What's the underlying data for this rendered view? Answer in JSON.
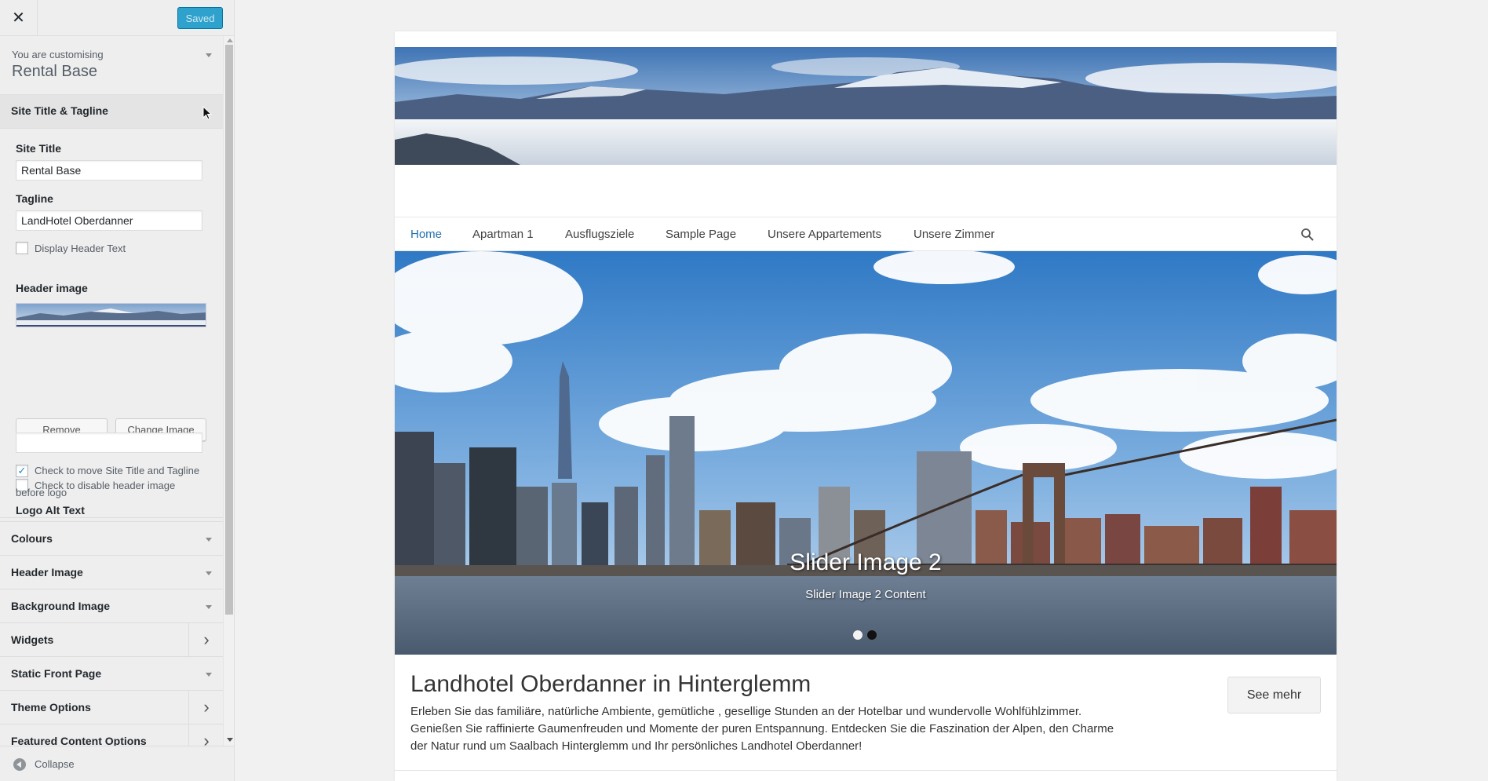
{
  "sidebar": {
    "close_icon": "close-icon",
    "saved_label": "Saved",
    "customising_label": "You are customising",
    "theme_name": "Rental Base",
    "open_section": {
      "title": "Site Title & Tagline",
      "site_title_label": "Site Title",
      "site_title_value": "Rental Base",
      "tagline_label": "Tagline",
      "tagline_value": "LandHotel Oberdanner",
      "display_header_text_label": "Display Header Text",
      "display_header_text_checked": false,
      "header_image_label": "Header image",
      "remove_label": "Remove",
      "change_image_label": "Change Image",
      "disable_header_label": "Check to disable header image",
      "disable_header_checked": false,
      "logo_alt_label": "Logo Alt Text",
      "logo_alt_value": "",
      "move_title_label_line1": "Check to move Site Title and Tagline",
      "move_title_label_line2": "before logo",
      "move_title_checked": true
    },
    "panels": [
      {
        "label": "Colours",
        "type": "dropdown"
      },
      {
        "label": "Header Image",
        "type": "dropdown"
      },
      {
        "label": "Background Image",
        "type": "dropdown"
      },
      {
        "label": "Widgets",
        "type": "chevron"
      },
      {
        "label": "Static Front Page",
        "type": "dropdown"
      },
      {
        "label": "Theme Options",
        "type": "chevron"
      },
      {
        "label": "Featured Content Options",
        "type": "chevron"
      }
    ],
    "collapse_label": "Collapse"
  },
  "preview": {
    "nav": [
      "Home",
      "Apartman 1",
      "Ausflugsziele",
      "Sample Page",
      "Unsere Appartements",
      "Unsere Zimmer"
    ],
    "active_nav": "Home",
    "slider": {
      "title": "Slider Image 2",
      "content": "Slider Image 2 Content",
      "dots_total": 2,
      "active_dot": 2
    },
    "intro_title": "Landhotel Oberdanner in Hinterglemm",
    "intro_text": "Erleben Sie das familiäre, natürliche Ambiente, gemütliche , gesellige Stunden an der Hotelbar und wundervolle Wohlfühlzimmer. Genießen Sie raffinierte Gaumenfreuden und Momente der puren Entspannung. Entdecken Sie die Faszination der Alpen, den Charme der Natur rund um Saalbach Hinterglemm und Ihr persönliches Landhotel Oberdanner!",
    "see_more_label": "See mehr"
  },
  "colors": {
    "accent": "#2ea2cc",
    "link": "#2271b1"
  }
}
